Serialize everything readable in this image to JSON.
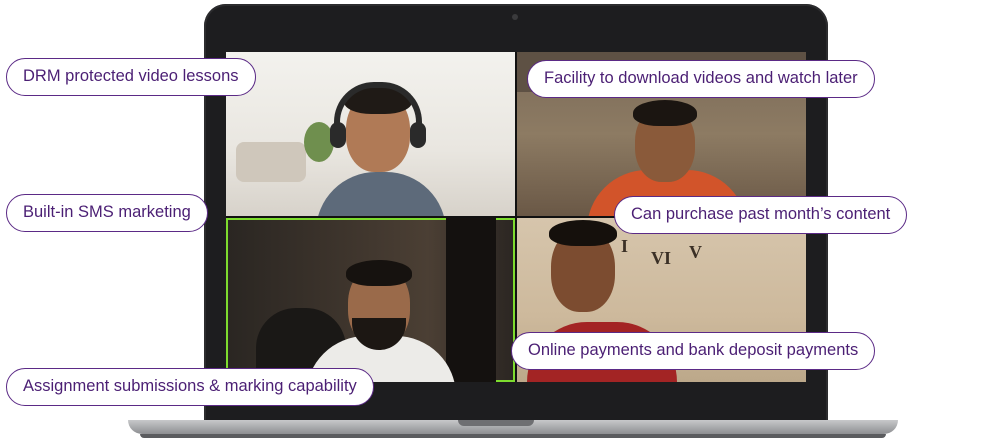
{
  "features": [
    "DRM protected video lessons",
    "Facility to download videos and watch later",
    "Built-in SMS marketing",
    "Can purchase past month’s content",
    "Online payments and bank deposit payments",
    "Assignment submissions & marking capability"
  ],
  "clock": {
    "numeral_left": "VI",
    "numeral_right": "V",
    "numeral_top": "I"
  },
  "colors": {
    "pill_border": "#5b2a86",
    "pill_text": "#4b1f74",
    "active_speaker_border": "#7ddc2e",
    "laptop_bezel": "#1d1d1f"
  }
}
